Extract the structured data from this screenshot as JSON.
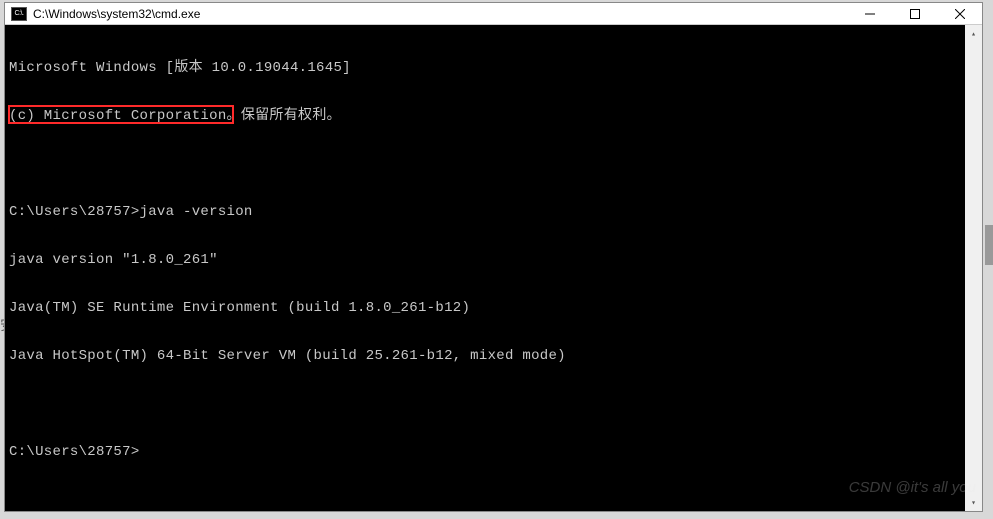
{
  "window": {
    "title": "C:\\Windows\\system32\\cmd.exe",
    "icon_text": "C:\\."
  },
  "terminal": {
    "lines": [
      "Microsoft Windows [版本 10.0.19044.1645]",
      "(c) Microsoft Corporation。保留所有权利。",
      "",
      "C:\\Users\\28757>java -version",
      "java version \"1.8.0_261\"",
      "Java(TM) SE Runtime Environment (build 1.8.0_261-b12)",
      "Java HotSpot(TM) 64-Bit Server VM (build 25.261-b12, mixed mode)",
      "",
      "C:\\Users\\28757>"
    ],
    "highlight_line_index": 4
  },
  "watermark": "CSDN @it's all you",
  "controls": {
    "minimize": "minimize",
    "maximize": "maximize",
    "close": "close"
  },
  "sidechar": "安"
}
